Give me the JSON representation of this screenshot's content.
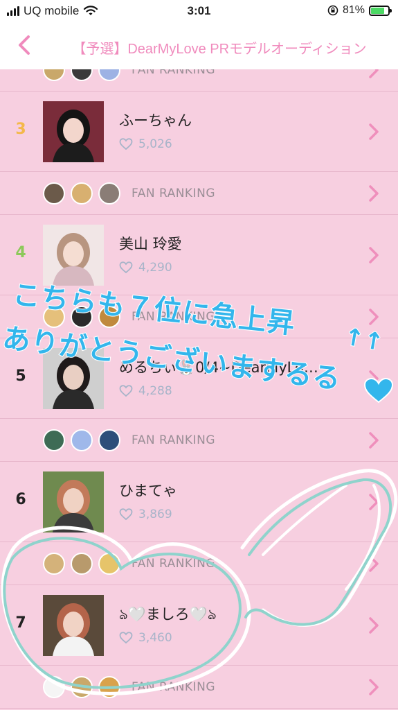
{
  "status_bar": {
    "carrier": "UQ mobile",
    "time": "3:01",
    "battery_percent": "81%",
    "battery_level": 0.81
  },
  "nav": {
    "back_icon": "chevron-left-icon",
    "title": "【予選】DearMyLove PRモデルオーディション"
  },
  "ranking": {
    "fan_label": "FAN RANKING",
    "rows": [
      {
        "type": "fan"
      },
      {
        "type": "member",
        "rank": "3",
        "rank_color": "#f4b84a",
        "name": "ふーちゃん",
        "likes": "5,026"
      },
      {
        "type": "fan"
      },
      {
        "type": "member",
        "rank": "4",
        "rank_color": "#8cc95a",
        "name": "美山 玲愛",
        "likes": "4,290"
      },
      {
        "type": "fan"
      },
      {
        "type": "member",
        "rank": "5",
        "rank_color": "#222222",
        "name": "めるちぃ🐰0/4~DearMyLo…",
        "likes": "4,288"
      },
      {
        "type": "fan"
      },
      {
        "type": "member",
        "rank": "6",
        "rank_color": "#222222",
        "name": "ひまてゃ",
        "likes": "3,869"
      },
      {
        "type": "fan"
      },
      {
        "type": "member",
        "rank": "7",
        "rank_color": "#222222",
        "name": "ঌ🤍ましろ🤍ঌ",
        "likes": "3,460"
      },
      {
        "type": "fan"
      }
    ]
  },
  "overlay": {
    "line1": "こちらも７位に急上昇",
    "line2": "ありがとうございまするる",
    "arrows": "↑↑",
    "heart_icon": "heart-icon",
    "color": "#33b6ec"
  }
}
